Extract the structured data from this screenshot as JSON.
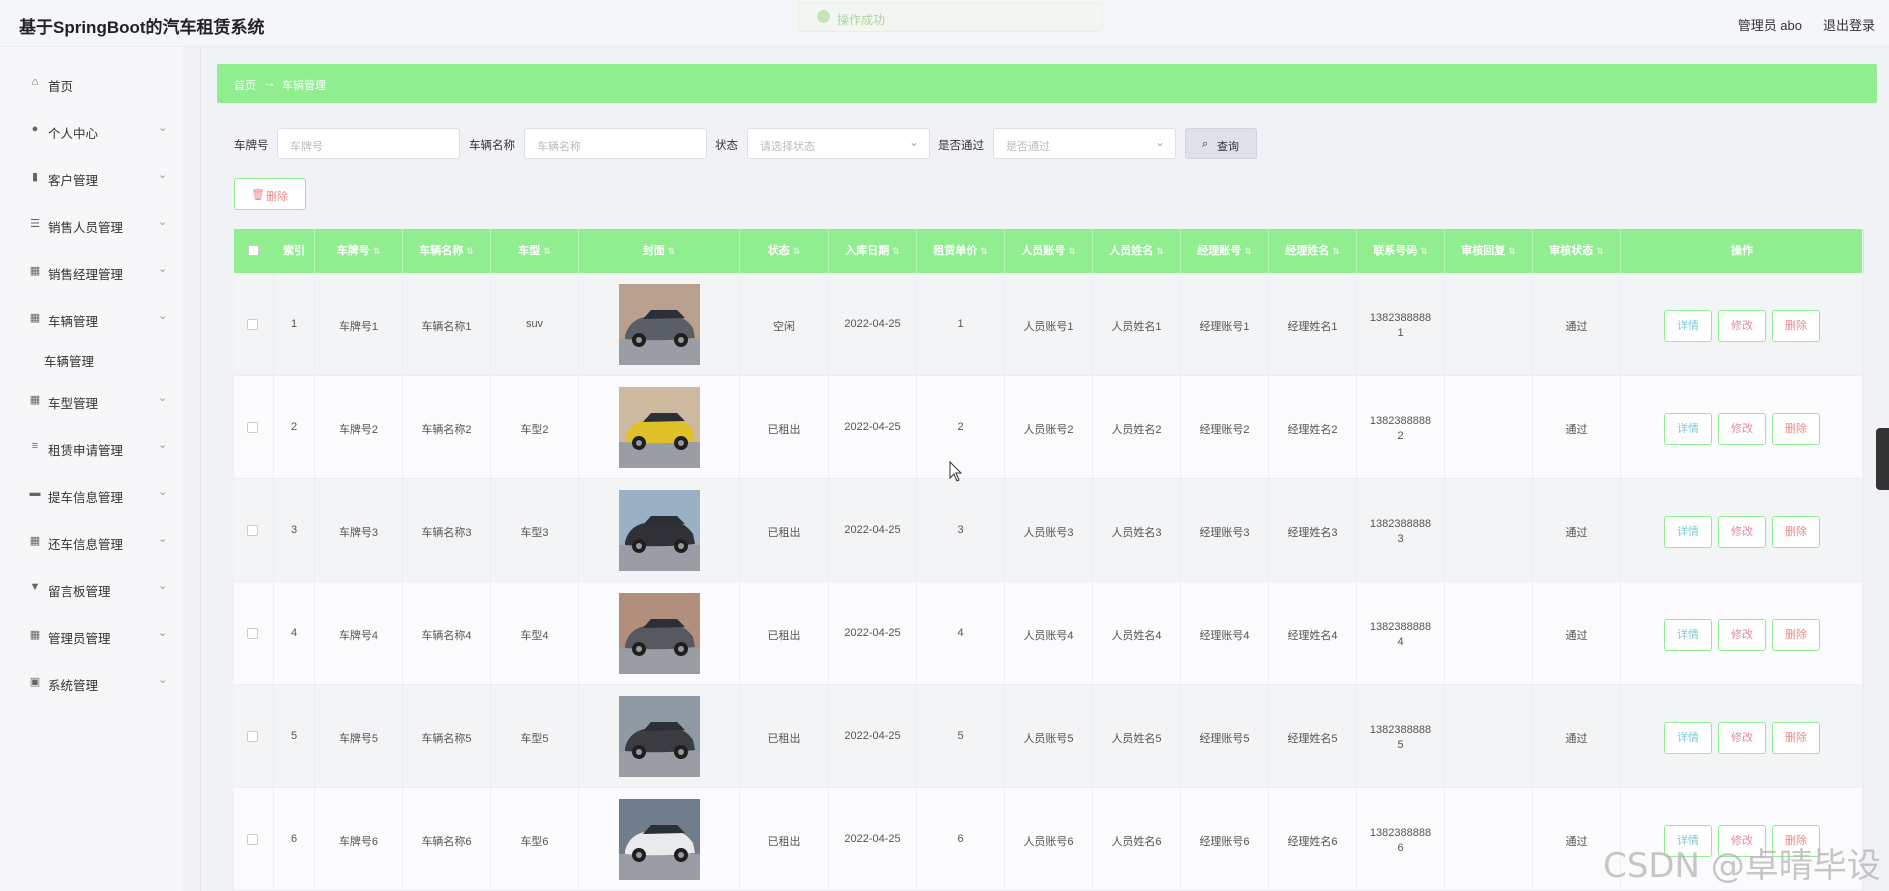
{
  "header": {
    "title": "基于SpringBoot的汽车租赁系统",
    "user": "管理员 abo",
    "logout": "退出登录"
  },
  "toast": {
    "text": "操作成功"
  },
  "sidebar": {
    "home": "首页",
    "items": [
      {
        "label": "个人中心",
        "icon": "user-icon"
      },
      {
        "label": "客户管理",
        "icon": "bar-chart-icon"
      },
      {
        "label": "销售人员管理",
        "icon": "list-icon"
      },
      {
        "label": "销售经理管理",
        "icon": "grid-icon"
      },
      {
        "label": "车辆管理",
        "icon": "grid-icon"
      },
      {
        "label": "车型管理",
        "icon": "table-icon"
      },
      {
        "label": "租赁申请管理",
        "icon": "sliders-icon"
      },
      {
        "label": "提车信息管理",
        "icon": "chat-icon"
      },
      {
        "label": "还车信息管理",
        "icon": "grid-icon"
      },
      {
        "label": "留言板管理",
        "icon": "trophy-icon"
      },
      {
        "label": "管理员管理",
        "icon": "grid-icon"
      },
      {
        "label": "系统管理",
        "icon": "clipboard-icon"
      }
    ],
    "sub_active": "车辆管理"
  },
  "breadcrumb": {
    "home": "首页",
    "sep": "→",
    "current": "车辆管理"
  },
  "filters": {
    "plate_label": "车牌号",
    "plate_placeholder": "车牌号",
    "name_label": "车辆名称",
    "name_placeholder": "车辆名称",
    "status_label": "状态",
    "status_placeholder": "请选择状态",
    "pass_label": "是否通过",
    "pass_placeholder": "是否通过",
    "query": "查询",
    "delete": "删除"
  },
  "table": {
    "headers": [
      "索引",
      "车牌号",
      "车辆名称",
      "车型",
      "封面",
      "状态",
      "入库日期",
      "租赁单价",
      "人员账号",
      "人员姓名",
      "经理账号",
      "经理姓名",
      "联系号码",
      "审核回复",
      "审核状态",
      "操作"
    ],
    "rows": [
      {
        "index": "1",
        "plate": "车牌号1",
        "name": "车辆名称1",
        "type": "suv",
        "status": "空闲",
        "date": "2022-04-25",
        "price": "1",
        "staff_acct": "人员账号1",
        "staff_name": "人员姓名1",
        "mgr_acct": "经理账号1",
        "mgr_name": "经理姓名1",
        "phone_a": "1382388888",
        "phone_b": "1",
        "reply": "",
        "audit": "通过"
      },
      {
        "index": "2",
        "plate": "车牌号2",
        "name": "车辆名称2",
        "type": "车型2",
        "status": "已租出",
        "date": "2022-04-25",
        "price": "2",
        "staff_acct": "人员账号2",
        "staff_name": "人员姓名2",
        "mgr_acct": "经理账号2",
        "mgr_name": "经理姓名2",
        "phone_a": "1382388888",
        "phone_b": "2",
        "reply": "",
        "audit": "通过"
      },
      {
        "index": "3",
        "plate": "车牌号3",
        "name": "车辆名称3",
        "type": "车型3",
        "status": "已租出",
        "date": "2022-04-25",
        "price": "3",
        "staff_acct": "人员账号3",
        "staff_name": "人员姓名3",
        "mgr_acct": "经理账号3",
        "mgr_name": "经理姓名3",
        "phone_a": "1382388888",
        "phone_b": "3",
        "reply": "",
        "audit": "通过"
      },
      {
        "index": "4",
        "plate": "车牌号4",
        "name": "车辆名称4",
        "type": "车型4",
        "status": "已租出",
        "date": "2022-04-25",
        "price": "4",
        "staff_acct": "人员账号4",
        "staff_name": "人员姓名4",
        "mgr_acct": "经理账号4",
        "mgr_name": "经理姓名4",
        "phone_a": "1382388888",
        "phone_b": "4",
        "reply": "",
        "audit": "通过"
      },
      {
        "index": "5",
        "plate": "车牌号5",
        "name": "车辆名称5",
        "type": "车型5",
        "status": "已租出",
        "date": "2022-04-25",
        "price": "5",
        "staff_acct": "人员账号5",
        "staff_name": "人员姓名5",
        "mgr_acct": "经理账号5",
        "mgr_name": "经理姓名5",
        "phone_a": "1382388888",
        "phone_b": "5",
        "reply": "",
        "audit": "通过"
      },
      {
        "index": "6",
        "plate": "车牌号6",
        "name": "车辆名称6",
        "type": "车型6",
        "status": "已租出",
        "date": "2022-04-25",
        "price": "6",
        "staff_acct": "人员账号6",
        "staff_name": "人员姓名6",
        "mgr_acct": "经理账号6",
        "mgr_name": "经理姓名6",
        "phone_a": "1382388888",
        "phone_b": "6",
        "reply": "",
        "audit": "通过"
      }
    ],
    "actions": {
      "detail": "详情",
      "edit": "修改",
      "delete": "删除"
    }
  },
  "covers": [
    {
      "body": "#5a5e66",
      "bg": "#b9a08f"
    },
    {
      "body": "#e0c12a",
      "bg": "#cdb8a0"
    },
    {
      "body": "#2f3136",
      "bg": "#9bb0c4"
    },
    {
      "body": "#55585e",
      "bg": "#b28f7c"
    },
    {
      "body": "#3a3c41",
      "bg": "#8f9aa5"
    },
    {
      "body": "#e9eaec",
      "bg": "#6f7d8c"
    }
  ],
  "colors": {
    "accent": "#90ee90",
    "page_bg": "#f0f2f5"
  },
  "watermark": "CSDN @卓晴毕设"
}
